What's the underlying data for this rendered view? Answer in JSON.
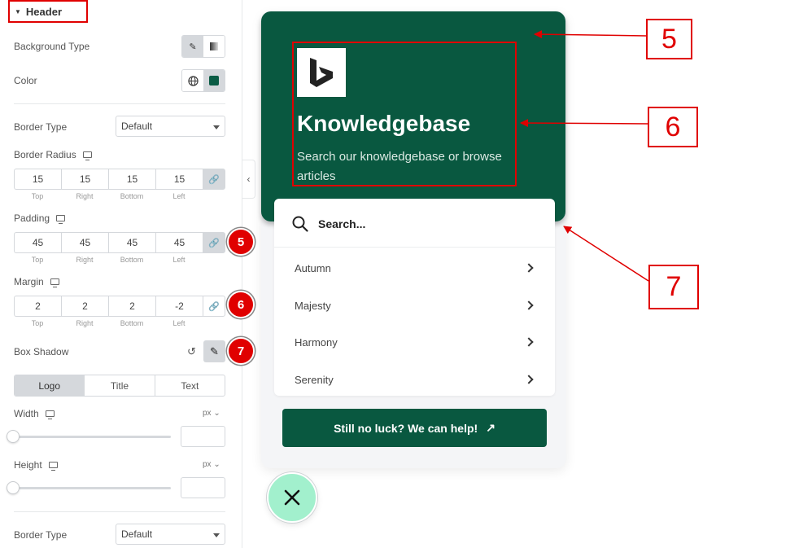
{
  "panel": {
    "section_title": "Header",
    "background_type_label": "Background Type",
    "color_label": "Color",
    "border_type_label": "Border Type",
    "border_type_value": "Default",
    "border_radius_label": "Border Radius",
    "border_radius": [
      "15",
      "15",
      "15",
      "15"
    ],
    "padding_label": "Padding",
    "padding": [
      "45",
      "45",
      "45",
      "45"
    ],
    "margin_label": "Margin",
    "margin": [
      "2",
      "2",
      "2",
      "-2"
    ],
    "dim_captions": [
      "Top",
      "Right",
      "Bottom",
      "Left"
    ],
    "box_shadow_label": "Box Shadow",
    "tabs": [
      "Logo",
      "Title",
      "Text"
    ],
    "active_tab": "Logo",
    "width_label": "Width",
    "height_label": "Height",
    "unit": "px",
    "width_slider_level": 0,
    "height_slider_level": 0,
    "border_type2_label": "Border Type",
    "border_type2_value": "Default",
    "header_color": "#0b5c45"
  },
  "badges": [
    "5",
    "6",
    "7"
  ],
  "preview": {
    "title": "Knowledgebase",
    "subtitle": "Search our knowledgebase or browse articles",
    "search_placeholder": "Search...",
    "items": [
      "Autumn",
      "Majesty",
      "Harmony",
      "Serenity"
    ],
    "help_button": "Still no luck? We can help!",
    "accent": "#095840",
    "fab_color": "#a2f0cd"
  },
  "callouts": [
    "5",
    "6",
    "7"
  ]
}
